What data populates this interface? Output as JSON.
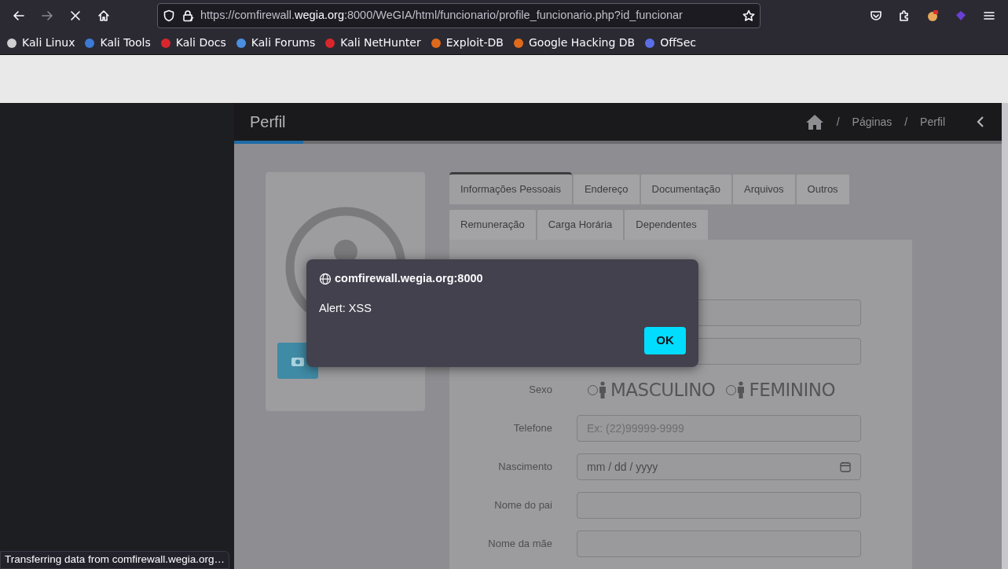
{
  "browser": {
    "url_prefix": "https://comfirewall.",
    "url_domain": "wegia.org",
    "url_rest": ":8000/WeGIA/html/funcionario/profile_funcionario.php?id_funcionar"
  },
  "bookmarks": [
    {
      "label": "Kali Linux",
      "color": "#cfcfcf"
    },
    {
      "label": "Kali Tools",
      "color": "#3b7bd6"
    },
    {
      "label": "Kali Docs",
      "color": "#d9262c"
    },
    {
      "label": "Kali Forums",
      "color": "#4a8fe0"
    },
    {
      "label": "Kali NetHunter",
      "color": "#d9262c"
    },
    {
      "label": "Exploit-DB",
      "color": "#e06a1b"
    },
    {
      "label": "Google Hacking DB",
      "color": "#e06a1b"
    },
    {
      "label": "OffSec",
      "color": "#5b6ee8"
    }
  ],
  "page_header": {
    "title": "Perfil",
    "breadcrumbs": [
      {
        "separator": "/",
        "label": "Páginas"
      },
      {
        "separator": "/",
        "label": "Perfil"
      }
    ]
  },
  "progress": {
    "level": 0.09
  },
  "tabs": [
    {
      "label": "Informações Pessoais",
      "selected": true
    },
    {
      "label": "Endereço",
      "selected": false
    },
    {
      "label": "Documentação",
      "selected": false
    },
    {
      "label": "Arquivos",
      "selected": false
    },
    {
      "label": "Outros",
      "selected": false
    },
    {
      "label": "Remuneração",
      "selected": false
    },
    {
      "label": "Carga Horária",
      "selected": false
    },
    {
      "label": "Dependentes",
      "selected": false
    }
  ],
  "form": {
    "rows": [
      {
        "kind": "text"
      },
      {
        "kind": "text"
      },
      {
        "kind": "radio",
        "label": "Sexo",
        "options": [
          {
            "label": "MASCULINO",
            "selected": false
          },
          {
            "label": "FEMININO",
            "selected": false
          }
        ]
      },
      {
        "kind": "text",
        "label": "Telefone",
        "placeholder": "Ex: (22)99999-9999"
      },
      {
        "kind": "date",
        "label": "Nascimento",
        "value": "mm / dd / yyyy"
      },
      {
        "kind": "text",
        "label": "Nome do pai"
      },
      {
        "kind": "text",
        "label": "Nome da mãe"
      }
    ]
  },
  "dialog": {
    "origin": "comfirewall.wegia.org:8000",
    "message": "Alert: XSS",
    "button": "OK"
  },
  "status_bar": "Transferring data from comfirewall.wegia.org…"
}
